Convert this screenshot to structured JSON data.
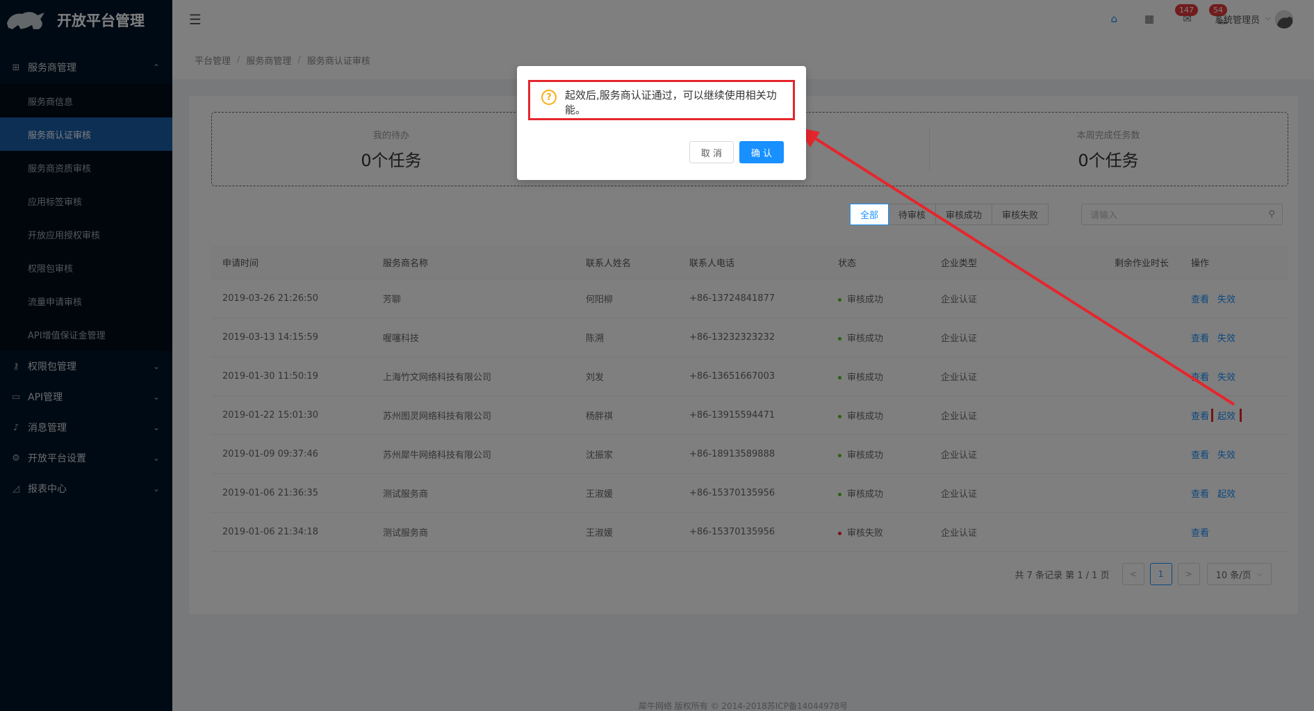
{
  "app": {
    "title": "开放平台管理"
  },
  "sidebar": {
    "groups": [
      {
        "label": "服务商管理",
        "icon": "grid-icon",
        "expanded": true,
        "items": [
          {
            "label": "服务商信息",
            "active": false
          },
          {
            "label": "服务商认证审核",
            "active": true
          },
          {
            "label": "服务商资质审核",
            "active": false
          },
          {
            "label": "应用标签审核",
            "active": false
          },
          {
            "label": "开放应用授权审核",
            "active": false
          },
          {
            "label": "权限包审核",
            "active": false
          },
          {
            "label": "流量申请审核",
            "active": false
          },
          {
            "label": "API增值保证金管理",
            "active": false
          }
        ]
      },
      {
        "label": "权限包管理",
        "icon": "key-icon",
        "expanded": false
      },
      {
        "label": "API管理",
        "icon": "api-icon",
        "expanded": false
      },
      {
        "label": "消息管理",
        "icon": "bell-icon",
        "expanded": false
      },
      {
        "label": "开放平台设置",
        "icon": "gear-icon",
        "expanded": false
      },
      {
        "label": "报表中心",
        "icon": "chart-icon",
        "expanded": false
      }
    ]
  },
  "header": {
    "mail_badge": "147",
    "bell_badge": "54",
    "user_name": "系统管理员"
  },
  "breadcrumb": [
    "平台管理",
    "服务商管理",
    "服务商认证审核"
  ],
  "stats": [
    {
      "label": "我的待办",
      "value": "0个任务"
    },
    {
      "label": "",
      "value": ""
    },
    {
      "label": "本周完成任务数",
      "value": "0个任务"
    }
  ],
  "filters": [
    "全部",
    "待审核",
    "审核成功",
    "审核失败"
  ],
  "search": {
    "placeholder": "请输入"
  },
  "table": {
    "headers": [
      "申请时间",
      "服务商名称",
      "联系人姓名",
      "联系人电话",
      "状态",
      "企业类型",
      "剩余作业时长",
      "操作"
    ],
    "rows": [
      {
        "time": "2019-03-26 21:26:50",
        "name": "芳聊",
        "contact": "何阳柳",
        "phone": "+86-13724841877",
        "status": "审核成功",
        "ok": true,
        "type": "企业认证",
        "view": "查看",
        "action": "失效"
      },
      {
        "time": "2019-03-13 14:15:59",
        "name": "喔噻科技",
        "contact": "陈溯",
        "phone": "+86-13232323232",
        "status": "审核成功",
        "ok": true,
        "type": "企业认证",
        "view": "查看",
        "action": "失效"
      },
      {
        "time": "2019-01-30 11:50:19",
        "name": "上海竹文网络科技有限公司",
        "contact": "刘发",
        "phone": "+86-13651667003",
        "status": "审核成功",
        "ok": true,
        "type": "企业认证",
        "view": "查看",
        "action": "失效"
      },
      {
        "time": "2019-01-22 15:01:30",
        "name": "苏州图灵网络科技有限公司",
        "contact": "杨胖祺",
        "phone": "+86-13915594471",
        "status": "审核成功",
        "ok": true,
        "type": "企业认证",
        "view": "查看",
        "action": "起效",
        "highlight": true
      },
      {
        "time": "2019-01-09 09:37:46",
        "name": "苏州犀牛网络科技有限公司",
        "contact": "沈振家",
        "phone": "+86-18913589888",
        "status": "审核成功",
        "ok": true,
        "type": "企业认证",
        "view": "查看",
        "action": "失效"
      },
      {
        "time": "2019-01-06 21:36:35",
        "name": "测试服务商",
        "contact": "王淑媛",
        "phone": "+86-15370135956",
        "status": "审核成功",
        "ok": true,
        "type": "企业认证",
        "view": "查看",
        "action": "起效"
      },
      {
        "time": "2019-01-06 21:34:18",
        "name": "测试服务商",
        "contact": "王淑媛",
        "phone": "+86-15370135956",
        "status": "审核失败",
        "ok": false,
        "type": "企业认证",
        "view": "查看",
        "action": ""
      }
    ]
  },
  "pagination": {
    "info": "共 7 条记录 第 1 / 1 页",
    "current": "1",
    "page_size": "10 条/页"
  },
  "footer": "犀牛网络 版权所有 © 2014-2018苏ICP备14044978号",
  "modal": {
    "message": "起效后,服务商认证通过，可以继续使用相关功能。",
    "cancel": "取 消",
    "confirm": "确 认"
  },
  "colors": {
    "sidebar_bg": "#001529",
    "accent": "#1890ff",
    "annotation_red": "#e5262d",
    "warning": "#faad14"
  }
}
